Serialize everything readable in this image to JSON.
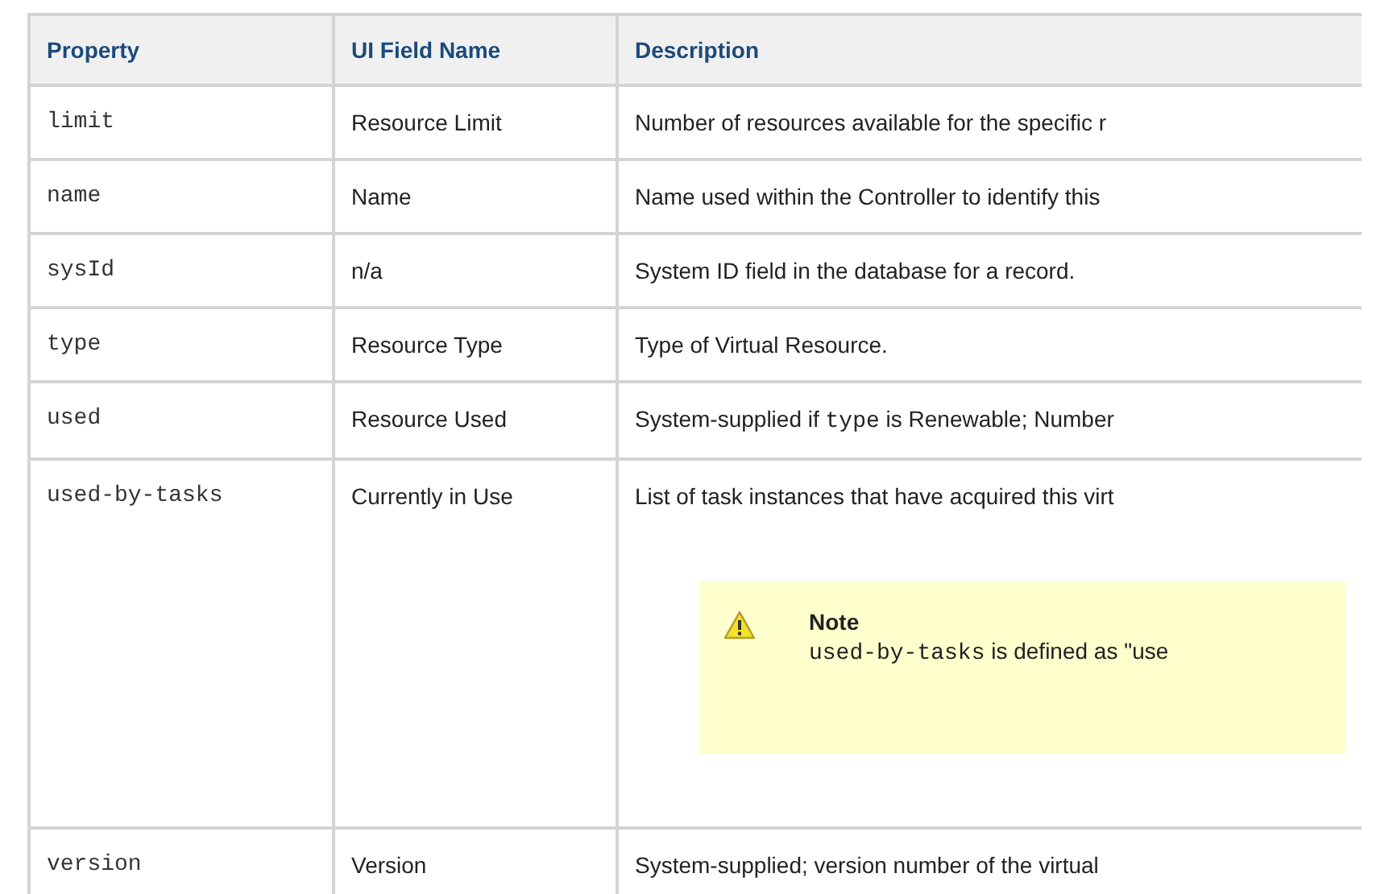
{
  "table": {
    "columns": [
      "Property",
      "UI Field Name",
      "Description"
    ],
    "rows": [
      {
        "property": "limit",
        "ui_field_name": "Resource Limit",
        "description": [
          {
            "kind": "text",
            "text": "Number of resources available for the specific r"
          }
        ]
      },
      {
        "property": "name",
        "ui_field_name": "Name",
        "description": [
          {
            "kind": "text",
            "text": "Name used within the Controller to identify this"
          }
        ]
      },
      {
        "property": "sysId",
        "ui_field_name": "n/a",
        "description": [
          {
            "kind": "text",
            "text": "System ID field in the database for a record."
          }
        ]
      },
      {
        "property": "type",
        "ui_field_name": "Resource Type",
        "description": [
          {
            "kind": "text",
            "text": "Type of Virtual Resource."
          }
        ]
      },
      {
        "property": "used",
        "ui_field_name": "Resource Used",
        "description": [
          {
            "kind": "text",
            "text": "System-supplied if "
          },
          {
            "kind": "code",
            "text": "type"
          },
          {
            "kind": "text",
            "text": " is Renewable; Number"
          }
        ]
      },
      {
        "property": "used-by-tasks",
        "ui_field_name": "Currently in Use",
        "description": [
          {
            "kind": "text",
            "text": "List of task instances that have acquired this virt"
          }
        ],
        "note": {
          "title": "Note",
          "body": [
            {
              "kind": "code",
              "text": "used-by-tasks"
            },
            {
              "kind": "text",
              "text": " is defined as \"use"
            }
          ]
        }
      },
      {
        "property": "version",
        "ui_field_name": "Version",
        "description": [
          {
            "kind": "text",
            "text": "System-supplied; version number of the virtual"
          }
        ]
      }
    ]
  }
}
